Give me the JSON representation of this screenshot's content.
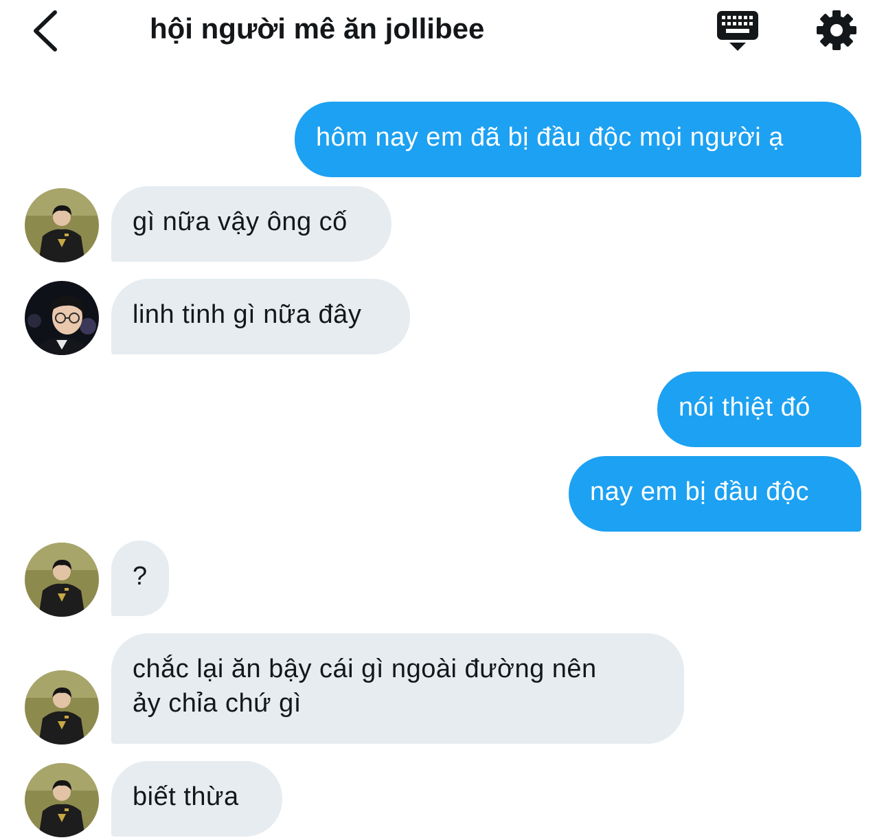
{
  "header": {
    "title": "hội người mê ăn jollibee",
    "back_icon": "chevron-left-icon",
    "keyboard_icon": "keyboard-icon",
    "settings_icon": "gear-icon"
  },
  "colors": {
    "outgoing_bubble": "#1da1f2",
    "incoming_bubble": "#e6ecf0",
    "text": "#14171a"
  },
  "messages": [
    {
      "direction": "outgoing",
      "text": "hôm nay em đã bị đầu độc mọi người ạ"
    },
    {
      "direction": "incoming",
      "sender_avatar": "avatar-jersey",
      "text": "gì nữa vậy ông cố"
    },
    {
      "direction": "incoming",
      "sender_avatar": "avatar-glasses",
      "text": "linh tinh gì nữa đây"
    },
    {
      "direction": "outgoing",
      "text": "nói thiệt đó"
    },
    {
      "direction": "outgoing",
      "text": "nay em bị đầu độc"
    },
    {
      "direction": "incoming",
      "sender_avatar": "avatar-jersey",
      "text": "?"
    },
    {
      "direction": "incoming",
      "sender_avatar": "avatar-jersey",
      "text_line1": "chắc lại ăn bậy cái gì ngoài đường nên",
      "text_line2": "ảy chỉa chứ gì"
    },
    {
      "direction": "incoming",
      "sender_avatar": "avatar-jersey",
      "text": "biết thừa"
    }
  ]
}
